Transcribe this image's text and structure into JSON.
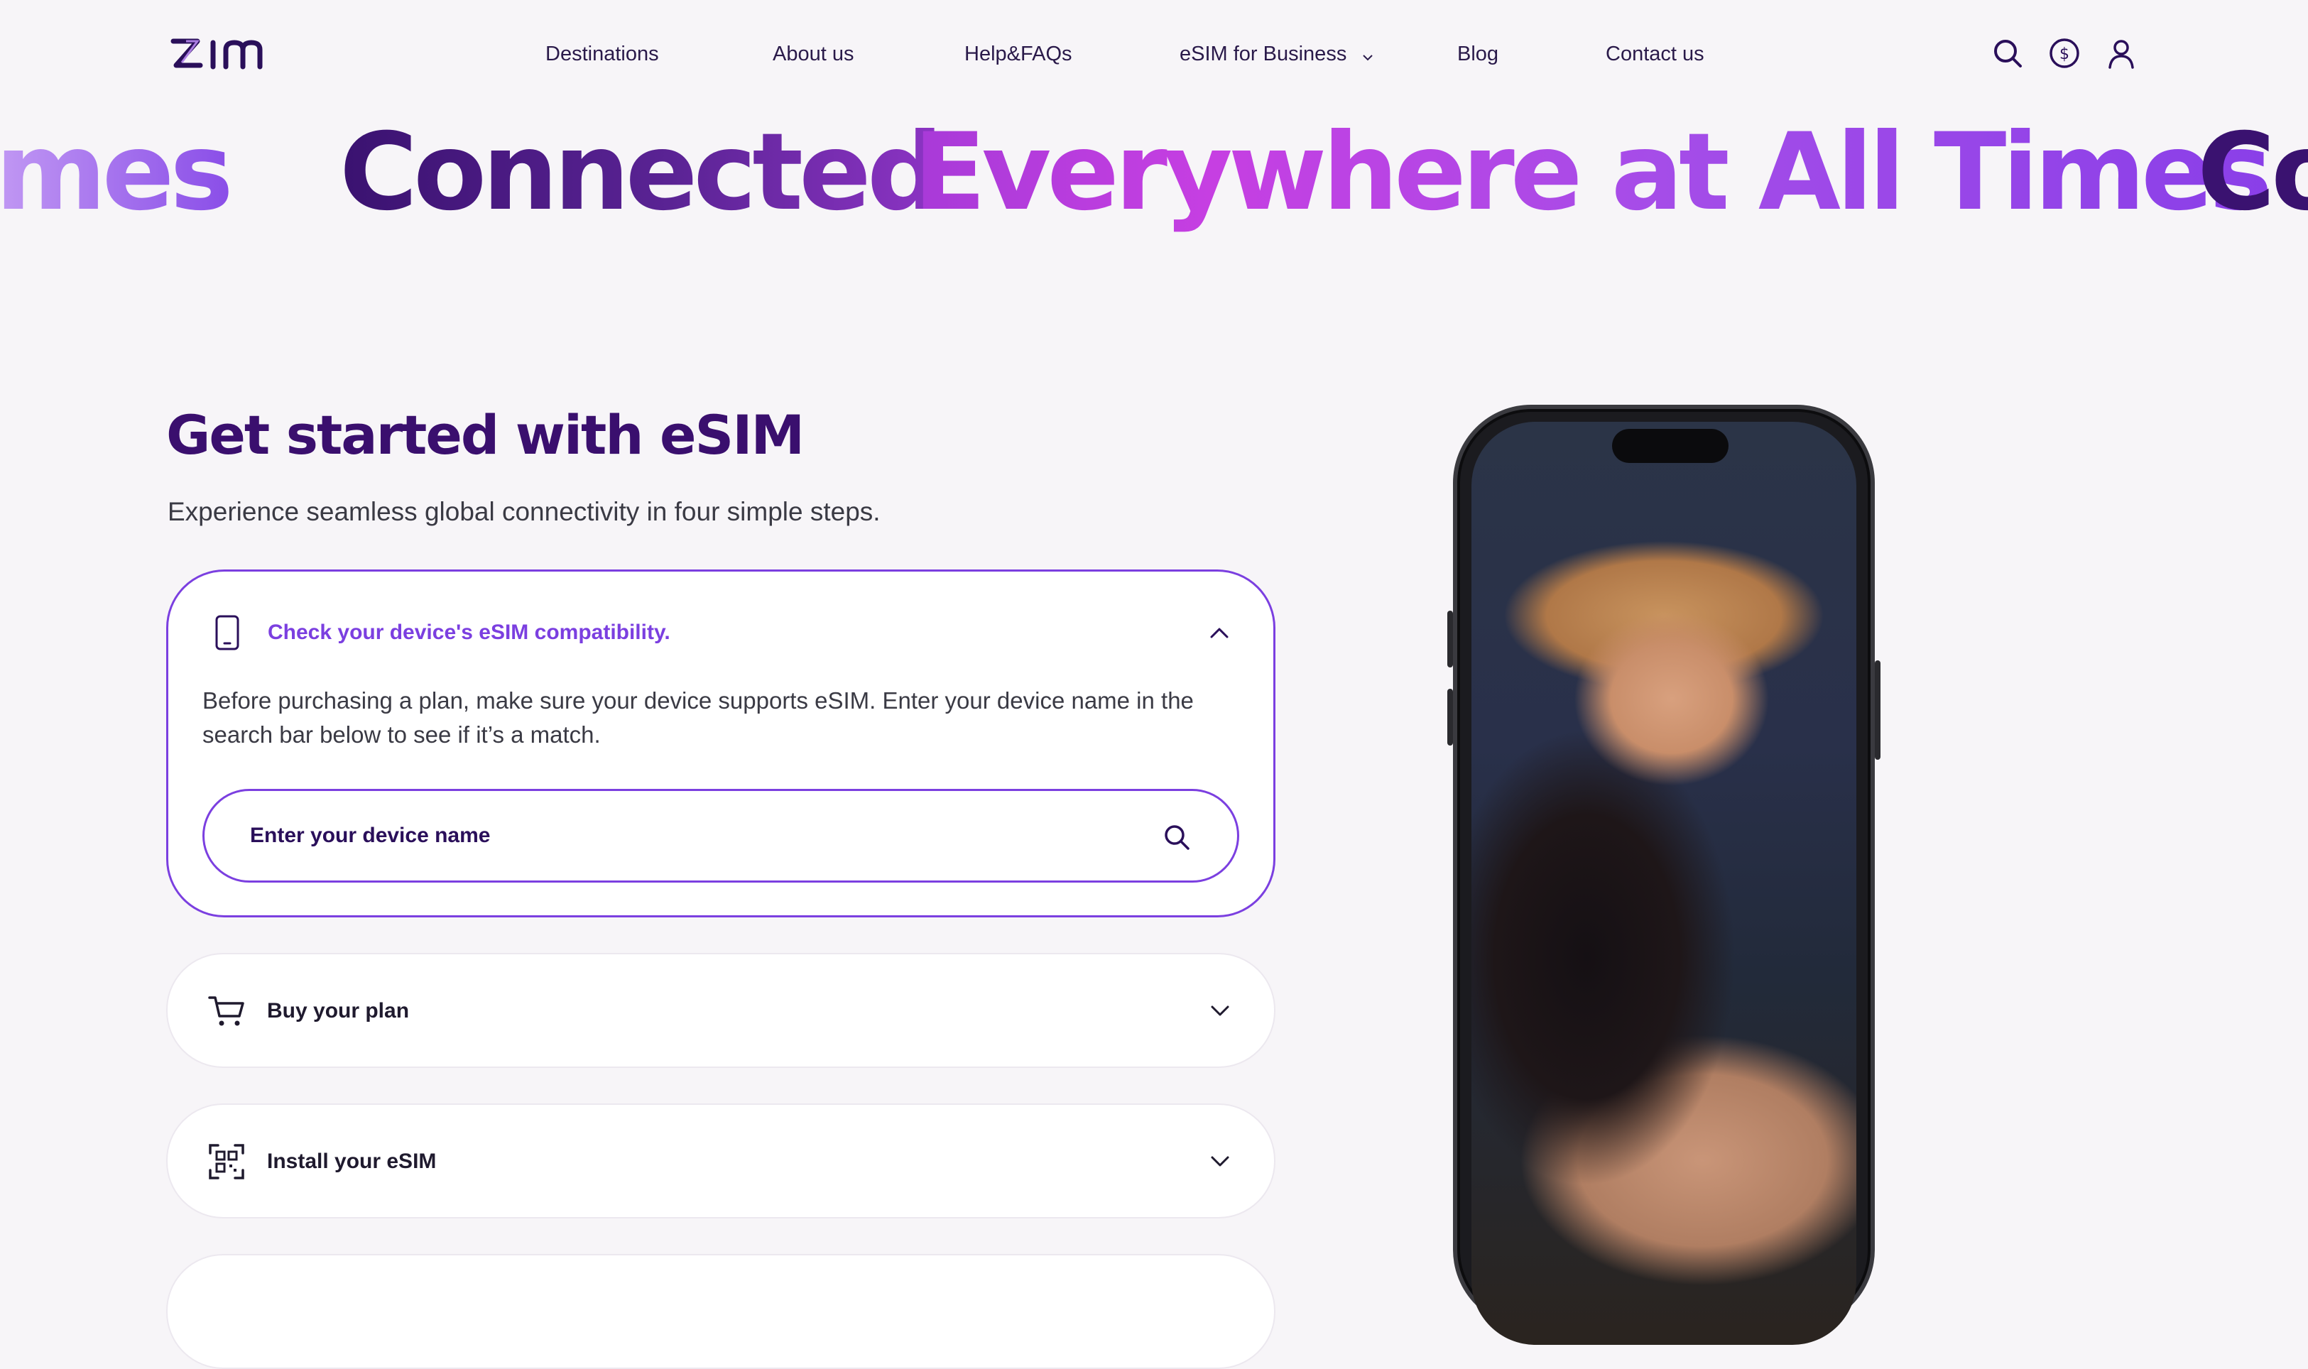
{
  "header": {
    "logo_text": "zim",
    "nav": [
      {
        "label": "Destinations"
      },
      {
        "label": "About us"
      },
      {
        "label": "Help&FAQs"
      },
      {
        "label": "eSIM for Business"
      },
      {
        "label": "Blog"
      },
      {
        "label": "Contact us"
      }
    ],
    "icons": [
      "search-icon",
      "currency-icon",
      "user-icon"
    ]
  },
  "marquee": {
    "fragment_left": "imes",
    "part1": "Connected",
    "part2": "Everywhere at All Times",
    "fragment_right": "Co"
  },
  "section": {
    "title": "Get started with eSIM",
    "subtitle": "Experience seamless global connectivity in four simple steps.",
    "steps": [
      {
        "label": "Check your device's eSIM compatibility.",
        "icon": "phone-icon",
        "expanded": true,
        "description": "Before purchasing a plan, make sure your device supports eSIM. Enter your device name in the search bar below to see if it’s a match.",
        "search_placeholder": "Enter your device name"
      },
      {
        "label": "Buy your plan",
        "icon": "cart-icon",
        "expanded": false
      },
      {
        "label": "Install your eSIM",
        "icon": "qr-scan-icon",
        "expanded": false
      }
    ]
  },
  "colors": {
    "accent": "#7b3fe0",
    "title": "#3a0f6e",
    "background": "#f7f5f8"
  }
}
